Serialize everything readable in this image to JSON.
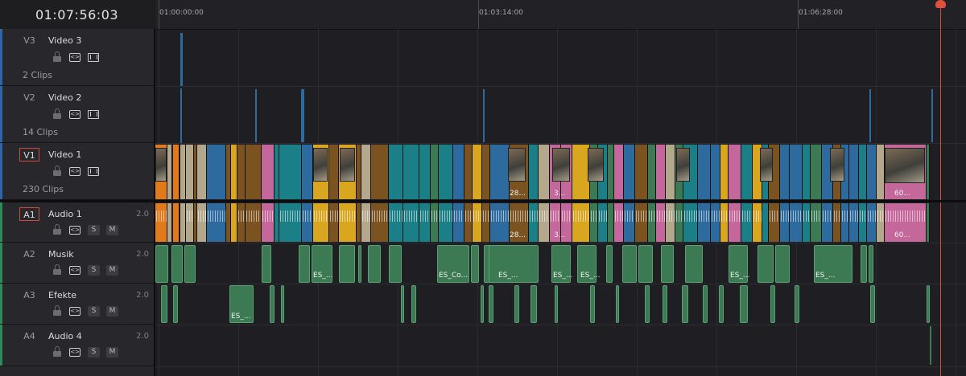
{
  "viewer": {
    "timecode": "01:07:56:03"
  },
  "ruler": {
    "marks": [
      "01:00:00:00",
      "01:03:14:00",
      "01:06:28:00"
    ]
  },
  "tracks": [
    {
      "id": "V3",
      "name": "Video 3",
      "count": "2 Clips",
      "type": "video",
      "color": "#2f65a6",
      "active": false
    },
    {
      "id": "V2",
      "name": "Video 2",
      "count": "14 Clips",
      "type": "video",
      "color": "#2f65a6",
      "active": false
    },
    {
      "id": "V1",
      "name": "Video 1",
      "count": "230 Clips",
      "type": "video",
      "color": "#2f65a6",
      "active": true
    },
    {
      "id": "A1",
      "name": "Audio 1",
      "level": "2.0",
      "type": "audio",
      "color": "#2e8b57",
      "active": true,
      "solo": "S",
      "mute": "M"
    },
    {
      "id": "A2",
      "name": "Musik",
      "level": "2.0",
      "type": "audio",
      "color": "#2e8b57",
      "active": false,
      "solo": "S",
      "mute": "M"
    },
    {
      "id": "A3",
      "name": "Efekte",
      "level": "2.0",
      "type": "audio",
      "color": "#2e8b57",
      "active": false,
      "solo": "S",
      "mute": "M"
    },
    {
      "id": "A4",
      "name": "Audio 4",
      "level": "2.0",
      "type": "audio",
      "color": "#2e8b57",
      "active": false,
      "solo": "S",
      "mute": "M"
    }
  ],
  "clip_labels": {
    "v1_a": "28...",
    "v1_b": "3...",
    "v1_c": "60...",
    "a1_a": "28...",
    "a1_b": "3...",
    "a1_c": "60...",
    "a2_a": "ES_...",
    "a2_b": "ES_Co...",
    "a2_c": "ES_...",
    "a2_d": "ES_...",
    "a2_e": "ES_...",
    "a2_f": "ES_...",
    "a2_g": "ES_...",
    "a3_a": "ES_..."
  },
  "icons": {
    "lock": "lock-icon",
    "auto_select": "auto-select-icon",
    "video_toggle": "film-strip-icon",
    "playhead": "playhead-marker",
    "link": "link-icon"
  },
  "colors": {
    "playhead": "#d94a3e",
    "orange": "#e07a1a",
    "beige": "#b3a88c",
    "teal": "#1a7f86",
    "blue": "#2d6a9e",
    "brown": "#7a5320",
    "pink": "#c4679a",
    "yellow": "#d8a61f",
    "green": "#3b7a52"
  }
}
